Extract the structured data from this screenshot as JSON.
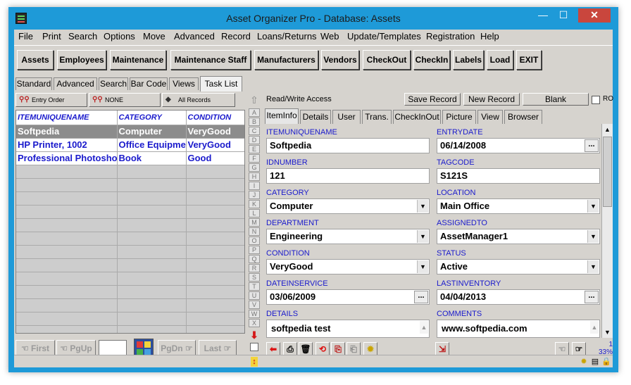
{
  "window": {
    "title": "Asset Organizer Pro - Database: Assets",
    "min_glyph": "—",
    "max_glyph": "☐",
    "close_glyph": "✕"
  },
  "menu": [
    "File",
    "Print",
    "Search",
    "Options",
    "Move",
    "Advanced",
    "Record",
    "Loans/Returns",
    "Web",
    "Update/Templates",
    "Registration",
    "Help"
  ],
  "toolbar": [
    "Assets",
    "Employees",
    "Maintenance",
    "Maintenance Staff",
    "Manufacturers",
    "Vendors",
    "CheckOut",
    "CheckIn",
    "Labels",
    "Load",
    "EXIT"
  ],
  "left_tabs": [
    "Standard",
    "Advanced",
    "Search",
    "Bar Code",
    "Views",
    "Task List"
  ],
  "sort_bar": {
    "order": "Entry Order",
    "filter": "NONE",
    "records": "All Records"
  },
  "grid": {
    "columns": [
      "ITEMUNIQUENAME",
      "CATEGORY",
      "CONDITION"
    ],
    "rows": [
      [
        "Softpedia",
        "Computer",
        "VeryGood"
      ],
      [
        "HP Printer, 1002",
        "Office Equipment",
        "VeryGood"
      ],
      [
        "Professional Photoshop",
        "Book",
        "Good"
      ]
    ]
  },
  "nav": {
    "first": "First",
    "pgup": "PgUp",
    "pgdn": "PgDn",
    "last": "Last"
  },
  "alphabet": [
    "A",
    "B",
    "C",
    "D",
    "E",
    "F",
    "G",
    "H",
    "I",
    "J",
    "K",
    "L",
    "M",
    "N",
    "O",
    "P",
    "Q",
    "R",
    "S",
    "T",
    "U",
    "V",
    "W",
    "X"
  ],
  "form_header": {
    "access": "Read/Write Access",
    "save": "Save Record",
    "new": "New Record",
    "blank": "Blank",
    "ro": "RO"
  },
  "form_tabs": [
    "ItemInfo",
    "Details",
    "User",
    "Trans.",
    "CheckInOut",
    "Picture",
    "View",
    "Browser"
  ],
  "fields": {
    "itemuniquename": {
      "label": "ITEMUNIQUENAME",
      "value": "Softpedia"
    },
    "entrydate": {
      "label": "ENTRYDATE",
      "value": "06/14/2008"
    },
    "idnumber": {
      "label": "IDNUMBER",
      "value": "121"
    },
    "tagcode": {
      "label": "TAGCODE",
      "value": "S121S"
    },
    "category": {
      "label": "CATEGORY",
      "value": "Computer"
    },
    "location": {
      "label": "LOCATION",
      "value": "Main Office"
    },
    "department": {
      "label": "DEPARTMENT",
      "value": "Engineering"
    },
    "assignedto": {
      "label": "ASSIGNEDTO",
      "value": "AssetManager1"
    },
    "condition": {
      "label": "CONDITION",
      "value": "VeryGood"
    },
    "status": {
      "label": "STATUS",
      "value": "Active"
    },
    "dateinservice": {
      "label": "DATEINSERVICE",
      "value": "03/06/2009"
    },
    "lastinventory": {
      "label": "LASTINVENTORY",
      "value": "04/04/2013"
    },
    "details": {
      "label": "DETAILS",
      "value": "softpedia test"
    },
    "comments": {
      "label": "COMMENTS",
      "value": "www.softpedia.com"
    }
  },
  "record": {
    "count": "1",
    "zoom": "33%"
  },
  "icons": {
    "dropdown": "▼",
    "ellipsis": "...",
    "scroll_up": "▲",
    "scroll_down": "▼",
    "az_up": "⇧",
    "az_down": "⬇"
  }
}
